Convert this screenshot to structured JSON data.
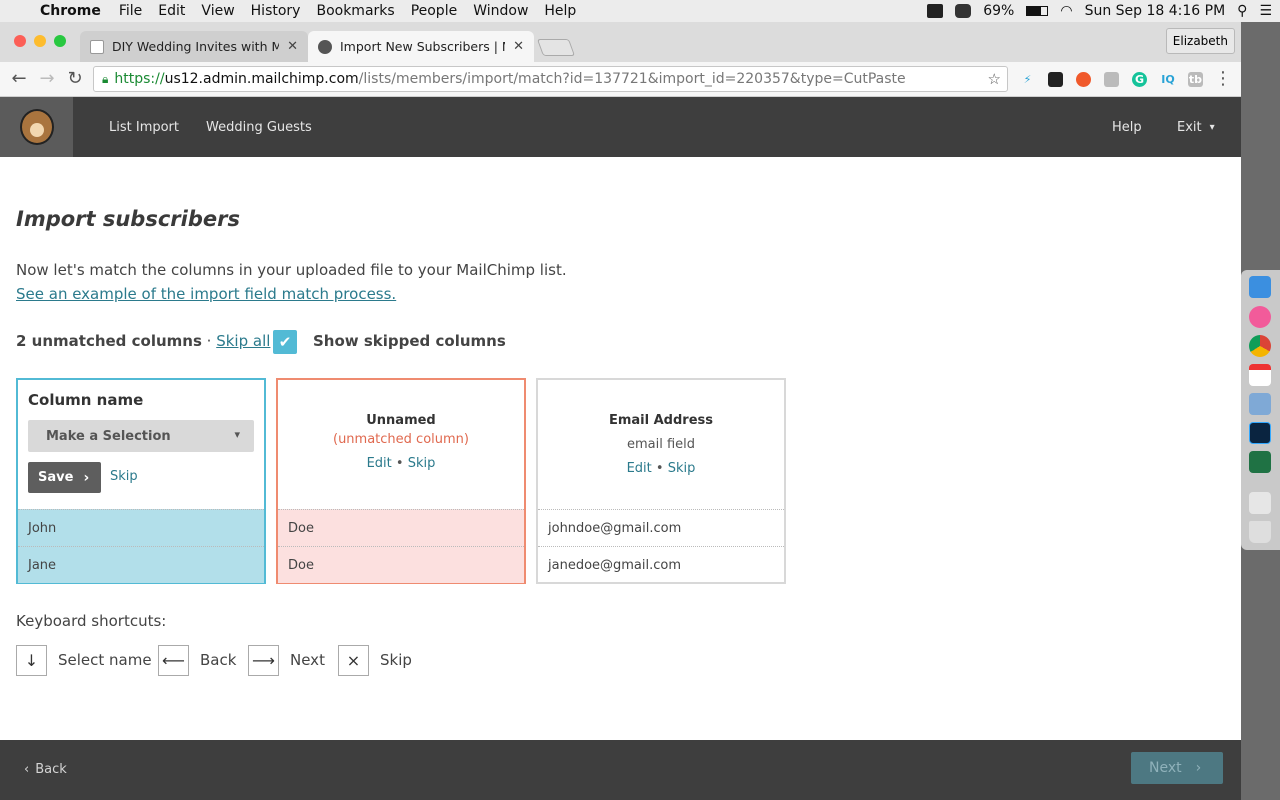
{
  "menubar": {
    "app": "Chrome",
    "items": [
      "File",
      "Edit",
      "View",
      "History",
      "Bookmarks",
      "People",
      "Window",
      "Help"
    ],
    "battery": "69%",
    "datetime": "Sun Sep 18  4:16 PM"
  },
  "browser": {
    "tabs": [
      {
        "title": "DIY Wedding Invites with Mailc"
      },
      {
        "title": "Import New Subscribers | Mailc"
      }
    ],
    "profile": "Elizabeth",
    "url": {
      "scheme": "https://",
      "host": "us12.admin.mailchimp.com",
      "path": "/lists/members/import/match?id=137721&import_id=220357&type=CutPaste"
    },
    "extensions": [
      "IQ",
      "tb"
    ]
  },
  "header": {
    "nav": [
      "List Import",
      "Wedding Guests"
    ],
    "help": "Help",
    "exit": "Exit"
  },
  "page": {
    "title": "Import subscribers",
    "lead": "Now let's match the columns in your uploaded file to your MailChimp list.",
    "example_link": "See an example of the import field match process.",
    "unmatched_count": "2 unmatched columns",
    "separator": " · ",
    "skip_all": "Skip all",
    "show_skipped": "Show skipped columns"
  },
  "columns": {
    "editing": {
      "label": "Column name",
      "select_value": "Make a Selection",
      "save": "Save",
      "skip": "Skip",
      "rows": [
        "John",
        "Jane"
      ]
    },
    "unnamed": {
      "title": "Unnamed",
      "status": "(unmatched column)",
      "edit": "Edit",
      "bullet": "•",
      "skip": "Skip",
      "rows": [
        "Doe",
        "Doe"
      ]
    },
    "email": {
      "title": "Email Address",
      "status": "email field",
      "edit": "Edit",
      "bullet": "•",
      "skip": "Skip",
      "rows": [
        "johndoe@gmail.com",
        "janedoe@gmail.com"
      ]
    }
  },
  "shortcuts": {
    "title": "Keyboard shortcuts:",
    "items": [
      {
        "key": "↓",
        "label": "Select name"
      },
      {
        "key": "⟵",
        "label": "Back"
      },
      {
        "key": "⟶",
        "label": "Next"
      },
      {
        "key": "×",
        "label": "Skip"
      }
    ]
  },
  "footer": {
    "back": "Back",
    "next": "Next"
  },
  "colors": {
    "accent_blue": "#52bad5",
    "unmatched_red": "#ef8b70",
    "link": "#2b7a8c",
    "header_bg": "#3e3e3e"
  }
}
